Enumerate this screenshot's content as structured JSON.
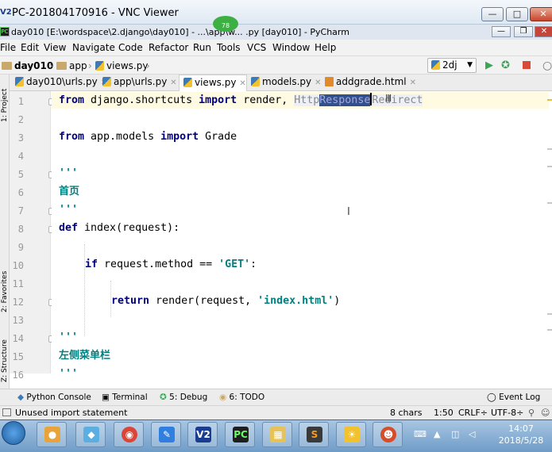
{
  "vnc_window": {
    "title": "PC-201804170916 - VNC Viewer",
    "logo": "V2",
    "buttons": [
      "minimize",
      "maximize",
      "close"
    ]
  },
  "pycharm_window": {
    "title": "day010 [E:\\wordspace\\2.django\\day010] - ...\\app\\w... .py [day010] - PyCharm",
    "badge": "78",
    "icon": "PC"
  },
  "menu": [
    "File",
    "Edit",
    "View",
    "Navigate",
    "Code",
    "Refactor",
    "Run",
    "Tools",
    "VCS",
    "Window",
    "Help"
  ],
  "breadcrumb": [
    "day010",
    "app",
    "views.py"
  ],
  "run_config": "2dj",
  "tabs": [
    {
      "label": "day010\\urls.py",
      "active": false
    },
    {
      "label": "app\\urls.py",
      "active": false
    },
    {
      "label": "views.py",
      "active": true
    },
    {
      "label": "models.py",
      "active": false
    },
    {
      "label": "addgrade.html",
      "active": false
    }
  ],
  "left_tool_windows": [
    "1: Project",
    "2: Favorites",
    "Z: Structure"
  ],
  "line_numbers": [
    "1",
    "2",
    "3",
    "4",
    "5",
    "6",
    "7",
    "8",
    "9",
    "10",
    "11",
    "12",
    "13",
    "14",
    "15",
    "16"
  ],
  "code": {
    "l1": {
      "kw1": "from",
      "mod": " django.shortcuts ",
      "kw2": "import",
      "name": " render, ",
      "unused_a": "Http",
      "sel": "Response",
      "unused_b": "Redirect"
    },
    "l3": {
      "kw1": "from",
      "mod": " app.models ",
      "kw2": "import",
      "name": " Grade"
    },
    "l5": "'''",
    "l6": "首页",
    "l7": "'''",
    "l8": {
      "kw": "def",
      "rest": " index(request):"
    },
    "l10": {
      "kw": "if",
      "mid": " request.method == ",
      "str": "'GET'",
      "end": ":"
    },
    "l12": {
      "kw": "return",
      "mid": " render(request, ",
      "str": "'index.html'",
      "end": ")"
    },
    "l14": "'''",
    "l15": "左侧菜单栏",
    "l16": "'''"
  },
  "tool_tabs": [
    "Python Console",
    "Terminal",
    "5: Debug",
    "6: TODO",
    "Event Log"
  ],
  "status": {
    "message": "Unused import statement",
    "chars": "8 chars",
    "position": "1:50",
    "line_sep": "CRLF÷",
    "encoding": "UTF-8÷"
  },
  "taskbar": {
    "time": "14:07",
    "date": "2018/5/28"
  }
}
